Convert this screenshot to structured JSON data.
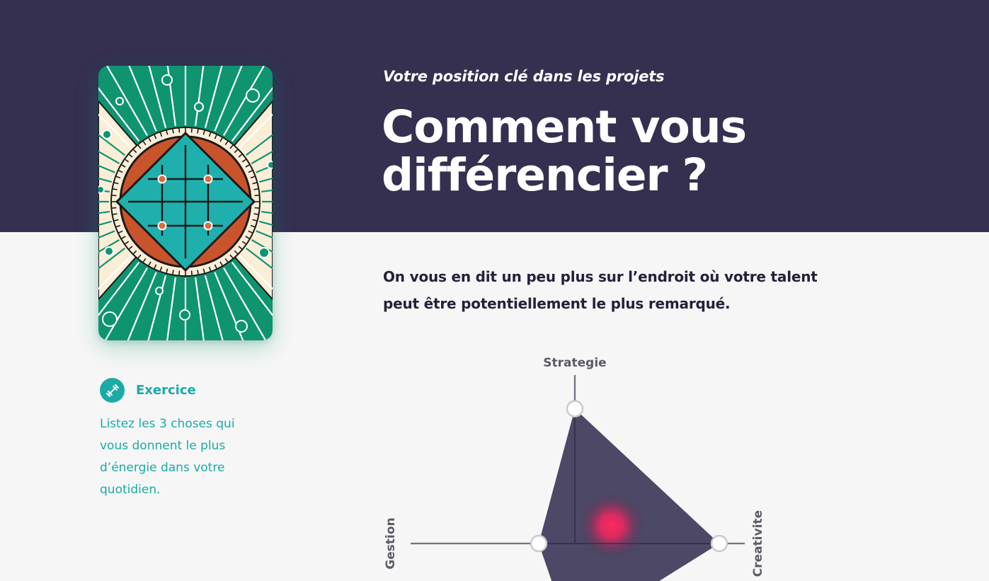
{
  "header": {
    "subtitle": "Votre position clé dans les projets",
    "title": "Comment vous différencier ?"
  },
  "intro": {
    "text": "On vous en dit un peu plus sur l’endroit où votre talent peut être potentiellement le plus remarqué."
  },
  "exercise": {
    "icon": "dumbbell-icon",
    "label": "Exercice",
    "text": "Listez les 3 choses qui vous donnent le plus d’énergie dans votre quotidien."
  },
  "colors": {
    "band": "#352f50",
    "accent": "#1aaba7",
    "card_green": "#0f9470",
    "card_cream": "#fbeed7",
    "card_orange": "#c9542c",
    "card_teal": "#1fb0ad",
    "radar_fill": "#3b3556",
    "radar_glow": "#ff2a62"
  },
  "chart_data": {
    "type": "radar",
    "axes": [
      {
        "label": "Strategie",
        "value": 0.8
      },
      {
        "label": "Creativite",
        "value": 0.85
      },
      {
        "label": "Gestion",
        "value": 0.22
      }
    ]
  }
}
